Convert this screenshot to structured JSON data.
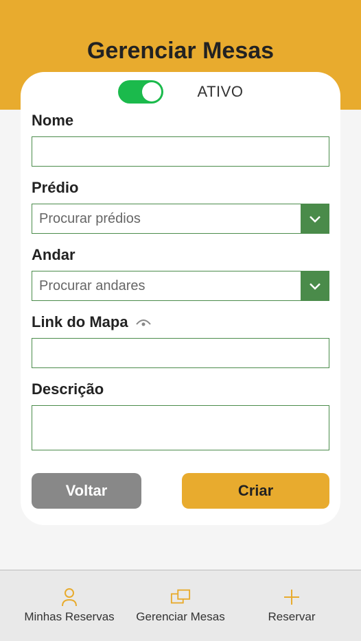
{
  "header": {
    "title": "Gerenciar Mesas"
  },
  "toggle": {
    "label": "ATIVO",
    "active": true
  },
  "fields": {
    "nome": {
      "label": "Nome",
      "value": ""
    },
    "predio": {
      "label": "Prédio",
      "placeholder": "Procurar prédios"
    },
    "andar": {
      "label": "Andar",
      "placeholder": "Procurar andares"
    },
    "link_mapa": {
      "label": "Link do Mapa",
      "value": ""
    },
    "descricao": {
      "label": "Descrição",
      "value": ""
    }
  },
  "buttons": {
    "back": "Voltar",
    "create": "Criar"
  },
  "nav": {
    "reservas": "Minhas Reservas",
    "gerenciar": "Gerenciar Mesas",
    "reservar": "Reservar"
  },
  "colors": {
    "accent": "#e8ab2e",
    "green": "#4a8b4a",
    "toggle_green": "#1bba4c"
  }
}
